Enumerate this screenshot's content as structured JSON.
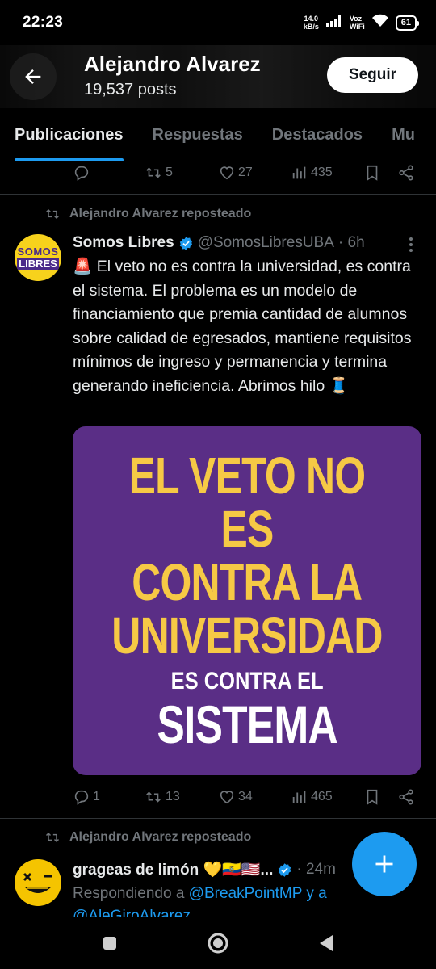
{
  "status_bar": {
    "time": "22:23",
    "net_speed_value": "14.0",
    "net_speed_unit": "kB/s",
    "voz_top": "Voz",
    "voz_bottom": "WiFi",
    "battery": "61"
  },
  "header": {
    "name": "Alejandro Alvarez",
    "posts": "19,537 posts",
    "follow_label": "Seguir"
  },
  "tabs": [
    {
      "label": "Publicaciones",
      "active": true
    },
    {
      "label": "Respuestas",
      "active": false
    },
    {
      "label": "Destacados",
      "active": false
    },
    {
      "label": "Mu",
      "active": false
    }
  ],
  "prev_tweet_actions": {
    "replies": "",
    "reposts": "5",
    "likes": "27",
    "views": "435"
  },
  "tweet1": {
    "repost_label": "Alejandro Alvarez reposteado",
    "avatar_text": [
      "SOMOS",
      "LIBRES"
    ],
    "name": "Somos Libres",
    "handle": "@SomosLibresUBA",
    "time": "· 6h",
    "text": "🚨 El veto no es contra la universidad, es contra el sistema. El problema es un modelo de financiamiento que premia cantidad de alumnos sobre calidad de egresados, mantiene requisitos mínimos de ingreso y permanencia y termina generando ineficiencia. Abrimos hilo 🧵",
    "media": {
      "line1": "EL VETO NO ES",
      "line2": "CONTRA LA",
      "line3": "UNIVERSIDAD",
      "line4": "ES CONTRA EL",
      "line5": "SISTEMA",
      "bg_color": "#5a2e86",
      "accent_color": "#f6c945"
    },
    "actions": {
      "replies": "1",
      "reposts": "13",
      "likes": "34",
      "views": "465"
    }
  },
  "tweet2": {
    "repost_label": "Alejandro Alvarez reposteado",
    "name": "grageas de limón 💛🇪🇨🇺🇸...",
    "time": "· 24m",
    "reply_prefix": "Respondiendo a",
    "reply_mention": "@BreakPointMP",
    "reply_suffix": "y a",
    "reply_mention2": "@AleGiroAlvarez"
  },
  "icons": {
    "back": "arrow-left-icon",
    "verified": "verified-badge-icon",
    "fab": "compose-plus-icon"
  },
  "colors": {
    "accent": "#1d9bf0",
    "muted": "#71767b",
    "background": "#000000"
  }
}
